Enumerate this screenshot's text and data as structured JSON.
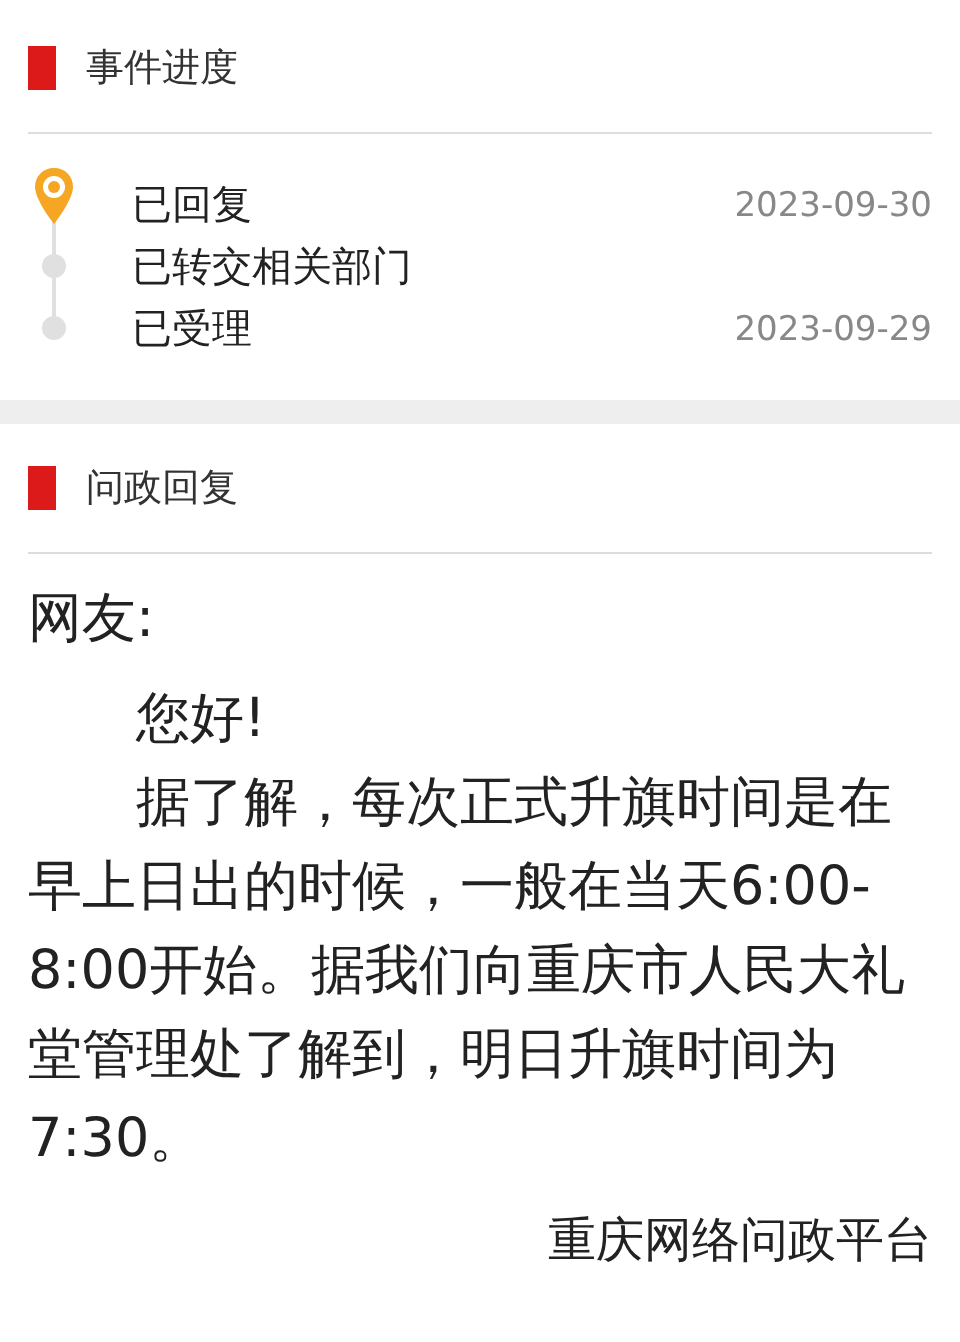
{
  "progress": {
    "title": "事件进度",
    "steps": [
      {
        "label": "已回复",
        "date": "2023-09-30",
        "current": true
      },
      {
        "label": "已转交相关部门",
        "current": false
      },
      {
        "label": "已受理",
        "date": "2023-09-29",
        "current": false
      }
    ]
  },
  "reply": {
    "title": "问政回复",
    "salutation": "网友:",
    "greeting": "您好!",
    "body": "据了解，每次正式升旗时间是在早上日出的时候，一般在当天6:00-8:00开始。据我们向重庆市人民大礼堂管理处了解到，明日升旗时间为7:30。",
    "signature": "重庆网络问政平台"
  }
}
